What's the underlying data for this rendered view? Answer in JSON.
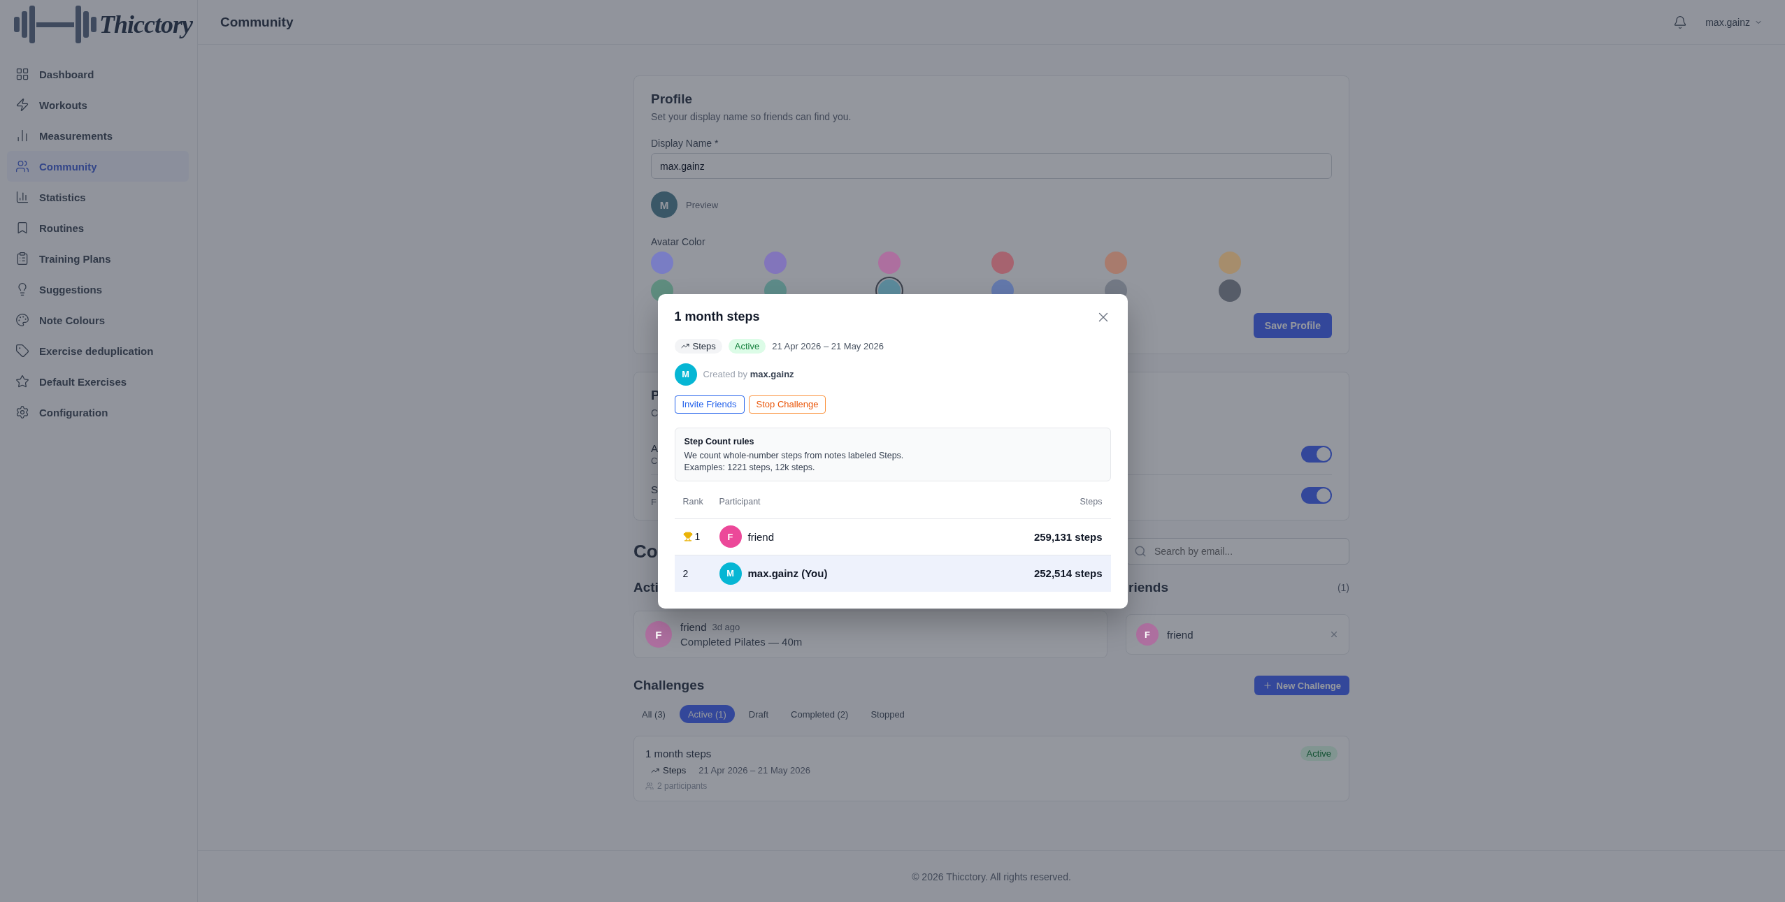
{
  "brand": {
    "name": "Thicctory"
  },
  "sidebar": {
    "items": [
      {
        "label": "Dashboard",
        "selected": false
      },
      {
        "label": "Workouts",
        "selected": false
      },
      {
        "label": "Measurements",
        "selected": false
      },
      {
        "label": "Community",
        "selected": true
      },
      {
        "label": "Statistics",
        "selected": false
      },
      {
        "label": "Routines",
        "selected": false
      },
      {
        "label": "Training Plans",
        "selected": false
      },
      {
        "label": "Suggestions",
        "selected": false
      },
      {
        "label": "Note Colours",
        "selected": false
      },
      {
        "label": "Exercise deduplication",
        "selected": false
      },
      {
        "label": "Default Exercises",
        "selected": false
      },
      {
        "label": "Configuration",
        "selected": false
      }
    ]
  },
  "header": {
    "title": "Community",
    "user": "max.gainz"
  },
  "profile": {
    "title": "Profile",
    "subtitle": "Set your display name so friends can find you.",
    "name_label": "Display Name *",
    "name_value": "max.gainz",
    "preview_initial": "M",
    "preview_label": "Preview",
    "color_label": "Avatar Color",
    "colors": [
      {
        "color": "#797dc4",
        "selected": false
      },
      {
        "color": "#8275bb",
        "selected": false
      },
      {
        "color": "#ad6f9f",
        "selected": false
      },
      {
        "color": "#a6636f",
        "selected": false
      },
      {
        "color": "#a87b6d",
        "selected": false
      },
      {
        "color": "#a68d6c",
        "selected": false
      },
      {
        "color": "#5f8d7f",
        "selected": false
      },
      {
        "color": "#5d8b89",
        "selected": false
      },
      {
        "color": "#5b8a9b",
        "selected": true
      },
      {
        "color": "#6378ab",
        "selected": false
      },
      {
        "color": "#737985",
        "selected": false
      },
      {
        "color": "#565c68",
        "selected": false
      }
    ],
    "save_button": "Save Profile"
  },
  "privacy": {
    "title": "P",
    "subtitle": "C",
    "settings": [
      {
        "label": "A",
        "description": "C",
        "on": true
      },
      {
        "label": "S",
        "description": "F",
        "on": true
      }
    ]
  },
  "community": {
    "title": "Co",
    "search": {
      "placeholder": "Search by email..."
    }
  },
  "activity": {
    "title": "Acti",
    "items": [
      {
        "initial": "F",
        "color": "#ad6f9f",
        "name": "friend",
        "time": "3d ago",
        "text": "Completed Pilates — 40m"
      }
    ]
  },
  "friends": {
    "title": "riends",
    "count": "(1)",
    "items": [
      {
        "initial": "F",
        "color": "#ad6f9f",
        "name": "friend"
      }
    ]
  },
  "challenges": {
    "title": "Challenges",
    "new_button": "New Challenge",
    "tabs": [
      {
        "label": "All (3)",
        "selected": false
      },
      {
        "label": "Active (1)",
        "selected": true
      },
      {
        "label": "Draft",
        "selected": false
      },
      {
        "label": "Completed (2)",
        "selected": false
      },
      {
        "label": "Stopped",
        "selected": false
      }
    ],
    "items": [
      {
        "title": "1 month steps",
        "status": "Active",
        "type": "Steps",
        "dates": "21 Apr 2026 – 21 May 2026",
        "participants": "2 participants"
      }
    ]
  },
  "footer": {
    "text": "© 2026 Thicctory. All rights reserved."
  },
  "modal": {
    "title": "1 month steps",
    "type": "Steps",
    "status": "Active",
    "dates": "21 Apr 2026 – 21 May 2026",
    "creator": {
      "initial": "M",
      "color": "#06b6d4",
      "prefix": "Created by",
      "name": "max.gainz"
    },
    "buttons": [
      {
        "label": "Invite Friends",
        "kind": "primary"
      },
      {
        "label": "Stop Challenge",
        "kind": "danger"
      }
    ],
    "rules": {
      "title": "Step Count rules",
      "lines": [
        "We count whole-number steps from notes labeled Steps.",
        "Examples: 1221 steps, 12k steps."
      ]
    },
    "leaderboard": {
      "columns": [
        "Rank",
        "Participant",
        "Steps"
      ],
      "rows": [
        {
          "rank": "1",
          "trophy": true,
          "initial": "F",
          "color": "#ec4899",
          "name": "friend",
          "steps": "259,131 steps",
          "selected": false
        },
        {
          "rank": "2",
          "trophy": false,
          "initial": "M",
          "color": "#06b6d4",
          "name": "max.gainz (You)",
          "steps": "252,514 steps",
          "selected": true
        }
      ]
    }
  }
}
